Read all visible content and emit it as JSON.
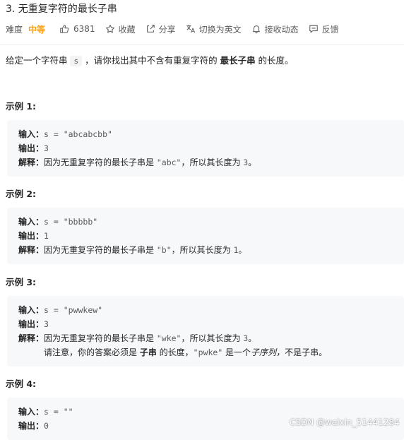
{
  "problem": {
    "title": "3. 无重复字符的最长子串",
    "difficulty_label": "难度",
    "difficulty": "中等",
    "likes": "6381",
    "actions": {
      "collect": "收藏",
      "share": "分享",
      "switch_lang": "切换为英文",
      "subscribe": "接收动态",
      "feedback": "反馈"
    }
  },
  "description": {
    "before": "给定一个字符串 ",
    "code": "s",
    "middle": " ，请你找出其中不含有重复字符的 ",
    "bold": "最长子串",
    "after": " 的长度。"
  },
  "labels": {
    "input": "输入：",
    "output": "输出：",
    "explain": "解释："
  },
  "examples": [
    {
      "title": "示例 1:",
      "input": "s = \"abcabcbb\"",
      "output": "3",
      "explain_before": "因为无重复字符的最长子串是 ",
      "explain_code": "\"abc\"",
      "explain_after": "，所以其长度为 ",
      "explain_num": "3",
      "explain_end": "。"
    },
    {
      "title": "示例 2:",
      "input": "s = \"bbbbb\"",
      "output": "1",
      "explain_before": "因为无重复字符的最长子串是 ",
      "explain_code": "\"b\"",
      "explain_after": "，所以其长度为 ",
      "explain_num": "1",
      "explain_end": "。"
    },
    {
      "title": "示例 3:",
      "input": "s = \"pwwkew\"",
      "output": "3",
      "explain_before": "因为无重复字符的最长子串是 ",
      "explain_code": "\"wke\"",
      "explain_after": "，所以其长度为 ",
      "explain_num": "3",
      "explain_end": "。",
      "note_before": "请注意，你的答案必须是 ",
      "note_bold": "子串",
      "note_mid": " 的长度，",
      "note_code": "\"pwke\"",
      "note_mid2": " 是一个",
      "note_italic": "子序列，",
      "note_end": "不是子串。"
    },
    {
      "title": "示例 4:",
      "input": "s = \"\"",
      "output": "0"
    }
  ],
  "watermark": "CSDN @weixin_51441284"
}
